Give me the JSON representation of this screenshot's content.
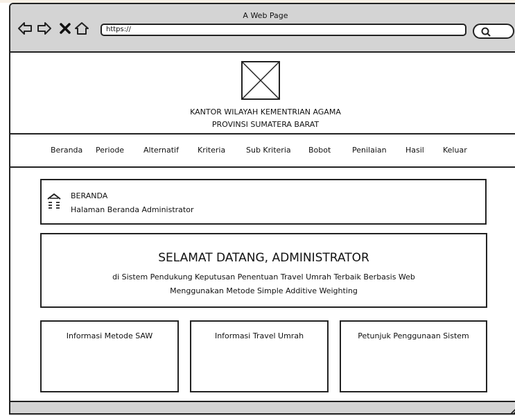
{
  "window": {
    "title": "A Web Page"
  },
  "browser": {
    "url": "https://",
    "icons": [
      "back-icon",
      "forward-icon",
      "close-icon",
      "home-icon",
      "search-icon"
    ]
  },
  "header": {
    "logo": "image-placeholder",
    "org_line1": "KANTOR WILAYAH KEMENTRIAN AGAMA",
    "org_line2": "PROVINSI SUMATERA BARAT"
  },
  "nav": {
    "items": [
      {
        "label": "Beranda"
      },
      {
        "label": "Periode"
      },
      {
        "label": "Alternatif"
      },
      {
        "label": "Kriteria"
      },
      {
        "label": "Sub Kriteria"
      },
      {
        "label": "Bobot"
      },
      {
        "label": "Penilaian"
      },
      {
        "label": "Hasil"
      },
      {
        "label": "Keluar"
      }
    ]
  },
  "breadcrumb": {
    "title": "BERANDA",
    "subtitle": "Halaman Beranda Administrator",
    "icon": "home-icon"
  },
  "welcome": {
    "title": "SELAMAT DATANG, ADMINISTRATOR",
    "line1": "di Sistem Pendukung Keputusan Penentuan Travel Umrah Terbaik Berbasis Web",
    "line2": "Menggunakan Metode Simple Additive Weighting"
  },
  "cards": [
    {
      "title": "Informasi Metode SAW"
    },
    {
      "title": "Informasi Travel Umrah"
    },
    {
      "title": "Petunjuk Penggunaan Sistem"
    }
  ],
  "colors": {
    "chrome": "#d4d4d4",
    "stroke": "#222222",
    "background": "#ffffff"
  }
}
